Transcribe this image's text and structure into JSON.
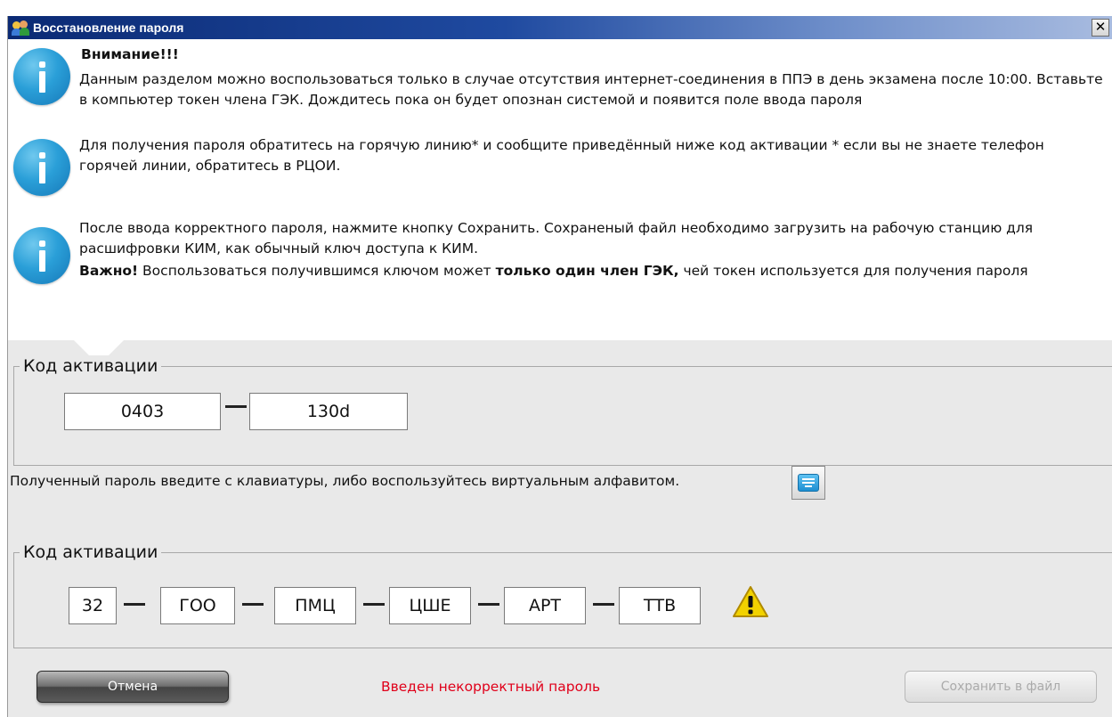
{
  "window": {
    "title": "Восстановление пароля",
    "close_label": "✕",
    "icon": "users-icon"
  },
  "info": {
    "attention_title": "Внимание!!!",
    "block1_text": "Данным разделом можно воспользоваться только в случае отсутствия интернет-соединения в ППЭ в день экзамена после 10:00. Вставьте в компьютер токен члена ГЭК. Дождитесь пока он будет опознан системой и появится поле ввода пароля",
    "block2_text": "Для получения пароля обратитесь на горячую линию* и сообщите приведённый ниже код активации  * если вы не знаете телефон горячей линии, обратитесь в РЦОИ.",
    "block3_text": "После ввода корректного пароля, нажмите кнопку Сохранить. Сохраненый файл необходимо загрузить на рабочую станцию для расшифровки КИМ, как обычный ключ доступа к КИМ.",
    "important_label": "Важно!",
    "important_text_1": " Воспользоваться получившимся ключом может ",
    "important_bold": "только один член ГЭК,",
    "important_text_2": " чей токен используется для получения пароля",
    "icon": "info-icon"
  },
  "activation": {
    "legend": "Код активации",
    "parts": [
      "0403",
      "130d"
    ]
  },
  "password_hint": "Полученный пароль введите с клавиатуры, либо воспользуйтесь виртуальным алфавитом.",
  "keyboard_icon": "keyboard-icon",
  "password": {
    "legend": "Код активации",
    "parts": [
      "32",
      "ГОО",
      "ПМЦ",
      "ЦШЕ",
      "АРТ",
      "ТТВ"
    ],
    "status_icon": "warning-icon",
    "warning_color": "#f2d200"
  },
  "footer": {
    "cancel_label": "Отмена",
    "error_message": "Введен некорректный пароль",
    "error_color": "#e0001a",
    "save_label": "Сохранить в файл"
  }
}
